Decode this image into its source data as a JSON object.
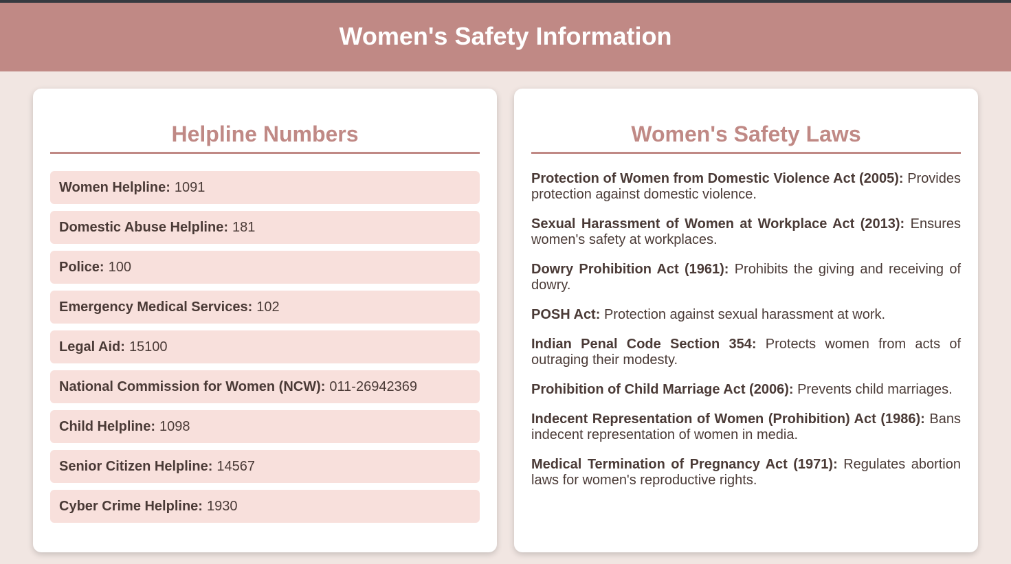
{
  "header": {
    "title": "Women's Safety Information"
  },
  "helplines": {
    "title": "Helpline Numbers",
    "items": [
      {
        "label": "Women Helpline:",
        "value": "1091"
      },
      {
        "label": "Domestic Abuse Helpline:",
        "value": "181"
      },
      {
        "label": "Police:",
        "value": "100"
      },
      {
        "label": "Emergency Medical Services:",
        "value": "102"
      },
      {
        "label": "Legal Aid:",
        "value": "15100"
      },
      {
        "label": "National Commission for Women (NCW):",
        "value": "011-26942369"
      },
      {
        "label": "Child Helpline:",
        "value": "1098"
      },
      {
        "label": "Senior Citizen Helpline:",
        "value": "14567"
      },
      {
        "label": "Cyber Crime Helpline:",
        "value": "1930"
      }
    ]
  },
  "laws": {
    "title": "Women's Safety Laws",
    "items": [
      {
        "name": "Protection of Women from Domestic Violence Act (2005):",
        "desc": "Provides protection against domestic violence."
      },
      {
        "name": "Sexual Harassment of Women at Workplace Act (2013):",
        "desc": "Ensures women's safety at workplaces."
      },
      {
        "name": "Dowry Prohibition Act (1961):",
        "desc": "Prohibits the giving and receiving of dowry."
      },
      {
        "name": "POSH Act:",
        "desc": "Protection against sexual harassment at work."
      },
      {
        "name": "Indian Penal Code Section 354:",
        "desc": "Protects women from acts of outraging their modesty."
      },
      {
        "name": "Prohibition of Child Marriage Act (2006):",
        "desc": "Prevents child marriages."
      },
      {
        "name": "Indecent Representation of Women (Prohibition) Act (1986):",
        "desc": "Bans indecent representation of women in media."
      },
      {
        "name": "Medical Termination of Pregnancy Act (1971):",
        "desc": "Regulates abortion laws for women's reproductive rights."
      }
    ]
  },
  "colors": {
    "header_bg": "#c08985",
    "page_bg": "#f1e6e2",
    "accent": "#c08985",
    "helpline_item_bg": "#f8e0dc",
    "text": "#4a3a36"
  }
}
